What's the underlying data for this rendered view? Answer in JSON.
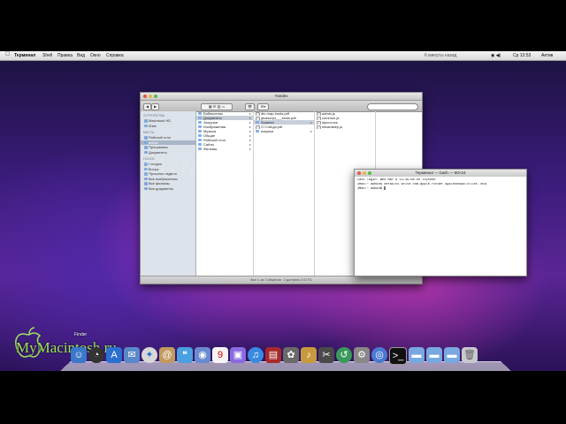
{
  "menubar": {
    "app": "Терминал",
    "items": [
      "Shell",
      "Правка",
      "Вид",
      "Окно",
      "Справка"
    ],
    "status_notice": "6 минуты назад",
    "clock": "Ср 13:53",
    "user": "Актив"
  },
  "finder": {
    "title": "Yandex",
    "status": "Все: 1 из 7 объектов · 2 доступно 2,01 ГБ",
    "sidebar": {
      "devices_header": "УСТРОЙСТВА",
      "devices": [
        "Macintosh HD",
        "iDisk"
      ],
      "places_header": "МЕСТА",
      "places": [
        "Рабочий стол",
        "admin",
        "Программы",
        "Документы"
      ],
      "search_header": "ПОИСК",
      "searches": [
        "Сегодня",
        "Вчера",
        "Прошлая неделя",
        "Все изображения",
        "Все фильмы",
        "Все документы"
      ]
    },
    "col1": [
      "Библиотеки",
      "Документы",
      "Загрузки",
      "Изображения",
      "Музыка",
      "Общие",
      "Рабочий стол",
      "Сайты",
      "Фильмы"
    ],
    "col2": [
      "dtc-map-hosts.pdf",
      "javascript___tricks.pdf",
      "Scanner",
      "O Стиндз.pdf",
      "покупки"
    ],
    "col3": [
      "admin.js",
      "common.js",
      "layout.css",
      "wizardstep.js"
    ]
  },
  "terminal": {
    "title": "Терминал — bash — 80×24",
    "lines": [
      "Last login: Wed Mar  9 13:49:08 on ttys000",
      "iMac:~ admin$ defaults write com.apple.finder AppleShowAllFiles TRUE",
      "iMac:~ admin$ "
    ]
  },
  "watermark": "MyMacintosh",
  "logo_text": "MyMacintosh.ru",
  "dock": {
    "hover_label": "Finder",
    "icons": [
      "finder-icon",
      "dashboard-icon",
      "safari-icon",
      "mail-icon",
      "address-book-icon",
      "ichat-icon",
      "calendar-icon",
      "itunes-icon",
      "iphoto-icon",
      "preview-icon",
      "utility-icon",
      "timemachine-icon",
      "system-prefs-icon",
      "terminal-icon",
      "folder-icon",
      "documents-icon",
      "downloads-icon",
      "trash-icon"
    ]
  },
  "colors": {
    "accent": "#7fb0e6",
    "logo": "#9ee35c"
  }
}
